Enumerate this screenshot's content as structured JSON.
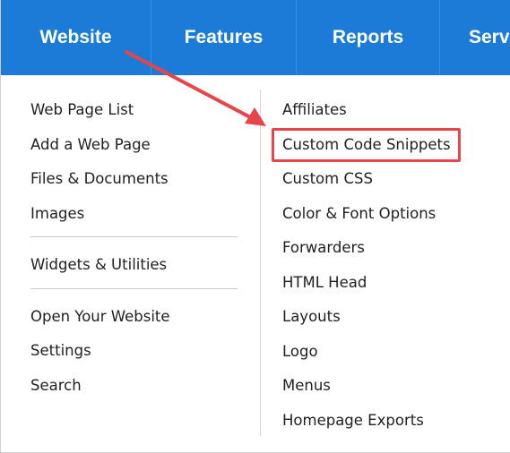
{
  "nav": {
    "tabs": [
      {
        "label": "Website"
      },
      {
        "label": "Features"
      },
      {
        "label": "Reports"
      },
      {
        "label": "Serv"
      }
    ]
  },
  "menu": {
    "left_group1": [
      "Web Page List",
      "Add a Web Page",
      "Files & Documents",
      "Images"
    ],
    "left_group2": [
      "Widgets & Utilities"
    ],
    "left_group3": [
      "Open Your Website",
      "Settings",
      "Search"
    ],
    "right_items": [
      "Affiliates",
      "Custom Code Snippets",
      "Custom CSS",
      "Color & Font Options",
      "Forwarders",
      "HTML Head",
      "Layouts",
      "Logo",
      "Menus",
      "Homepage Exports"
    ]
  },
  "annotation": {
    "arrow_color": "#e8454a",
    "highlight_color": "#e8454a"
  },
  "colors": {
    "nav_background": "#1b7bd6",
    "nav_text": "#ffffff"
  }
}
